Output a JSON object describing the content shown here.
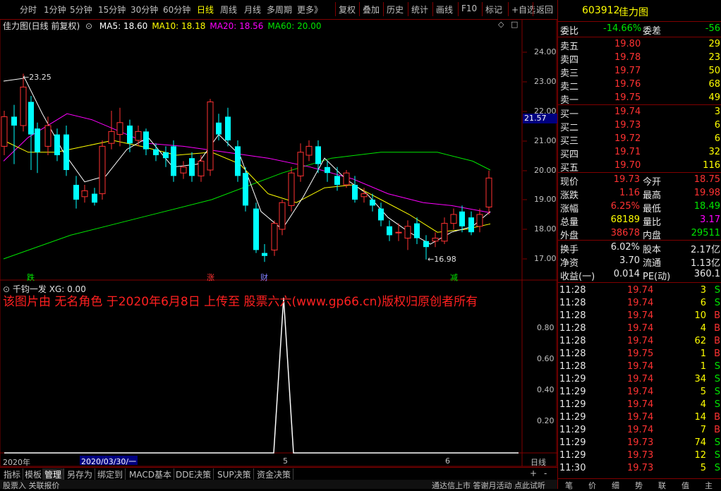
{
  "toolbar": {
    "left_items": [
      "分时",
      "1分钟",
      "5分钟",
      "15分钟",
      "30分钟",
      "60分钟",
      "日线",
      "周线",
      "月线",
      "多周期",
      "更多》"
    ],
    "active": "日线",
    "right_items": [
      "复权",
      "叠加",
      "历史",
      "统计",
      "画线",
      "F10",
      "标记",
      "+自选",
      "返回"
    ]
  },
  "main": {
    "title": "佳力图(日线 前复权)",
    "ma_labels": [
      {
        "text": "MA5: 18.60",
        "color": "#ffffff"
      },
      {
        "text": "MA10: 18.18",
        "color": "#ffff00"
      },
      {
        "text": "MA20: 18.56",
        "color": "#ff00ff"
      },
      {
        "text": "MA60: 20.00",
        "color": "#00e600"
      }
    ],
    "price_axis": [
      "24.00",
      "23.00",
      "22.00",
      "21.00",
      "20.00",
      "19.00",
      "18.00",
      "17.00"
    ],
    "current_price_tag": "21.57",
    "high_note": "23.25",
    "low_note": "16.98",
    "event_markers": [
      {
        "text": "跌",
        "color": "#00e600"
      },
      {
        "text": "涨",
        "color": "#ff3232"
      },
      {
        "text": "财",
        "color": "#8080ff"
      },
      {
        "text": "减",
        "color": "#00e600"
      }
    ],
    "pin_icon": "◇",
    "sq_icon": "□"
  },
  "indicator": {
    "name": "千钧一发",
    "value_label": "XG: 0.00",
    "watermark": "该图片由 无名角色 于2020年6月8日 上传至 股票六六(www.gp66.cn)版权归原创者所有",
    "axis": [
      "0.80",
      "0.60",
      "0.40",
      "0.20"
    ]
  },
  "dateaxis": {
    "year": "2020年",
    "cursor_date": "2020/03/30/一",
    "month5": "5",
    "month6": "6",
    "period": "日线"
  },
  "bottom_tabs": [
    "指标",
    "模板",
    "管理",
    "另存为",
    "绑定到",
    "MACD基本",
    "DDE决策",
    "SUP决策",
    "资金决策"
  ],
  "bottom_active": "管理",
  "bottom_right": [
    "+",
    "-"
  ],
  "status": {
    "left": "股票入 关联报价",
    "right": "通达信上市 答谢月活动 点此试听",
    "right_tabs": [
      "笔",
      "价",
      "细",
      "势",
      "联",
      "值",
      "主"
    ]
  },
  "quote": {
    "code": "603912",
    "name": "佳力图",
    "weibi_label": "委比",
    "weibi_value": "-14.66%",
    "weicha_label": "委差",
    "weicha_value": "-56",
    "sells": [
      {
        "label": "卖五",
        "price": "19.80",
        "vol": "29"
      },
      {
        "label": "卖四",
        "price": "19.78",
        "vol": "23"
      },
      {
        "label": "卖三",
        "price": "19.77",
        "vol": "50"
      },
      {
        "label": "卖二",
        "price": "19.76",
        "vol": "68"
      },
      {
        "label": "卖一",
        "price": "19.75",
        "vol": "49"
      }
    ],
    "buys": [
      {
        "label": "买一",
        "price": "19.74",
        "vol": "3"
      },
      {
        "label": "买二",
        "price": "19.73",
        "vol": "6"
      },
      {
        "label": "买三",
        "price": "19.72",
        "vol": "6"
      },
      {
        "label": "买四",
        "price": "19.71",
        "vol": "32"
      },
      {
        "label": "买五",
        "price": "19.70",
        "vol": "116"
      }
    ],
    "stats": [
      {
        "l1": "现价",
        "v1": "19.73",
        "c1": "red",
        "l2": "今开",
        "v2": "18.75",
        "c2": "red"
      },
      {
        "l1": "涨跌",
        "v1": "1.16",
        "c1": "red",
        "l2": "最高",
        "v2": "19.98",
        "c2": "red"
      },
      {
        "l1": "涨幅",
        "v1": "6.25%",
        "c1": "red",
        "l2": "最低",
        "v2": "18.49",
        "c2": "green"
      },
      {
        "l1": "总量",
        "v1": "68189",
        "c1": "yellow",
        "l2": "量比",
        "v2": "3.17",
        "c2": "magenta"
      },
      {
        "l1": "外盘",
        "v1": "38678",
        "c1": "red",
        "l2": "内盘",
        "v2": "29511",
        "c2": "green"
      }
    ],
    "stats2": [
      {
        "l1": "换手",
        "v1": "6.02%",
        "c1": "white",
        "l2": "股本",
        "v2": "2.17亿",
        "c2": "white"
      },
      {
        "l1": "净资",
        "v1": "3.70",
        "c1": "white",
        "l2": "流通",
        "v2": "1.13亿",
        "c2": "white"
      },
      {
        "l1": "收益(一)",
        "v1": "0.014",
        "c1": "white",
        "l2": "PE(动)",
        "v2": "360.1",
        "c2": "white"
      }
    ],
    "ticks": [
      {
        "t": "11:28",
        "p": "19.74",
        "v": "3",
        "s": "S"
      },
      {
        "t": "11:28",
        "p": "19.74",
        "v": "6",
        "s": "S"
      },
      {
        "t": "11:28",
        "p": "19.74",
        "v": "10",
        "s": "B"
      },
      {
        "t": "11:28",
        "p": "19.74",
        "v": "4",
        "s": "B"
      },
      {
        "t": "11:28",
        "p": "19.74",
        "v": "62",
        "s": "B"
      },
      {
        "t": "11:28",
        "p": "19.75",
        "v": "1",
        "s": "B"
      },
      {
        "t": "11:28",
        "p": "19.74",
        "v": "1",
        "s": "S"
      },
      {
        "t": "11:29",
        "p": "19.74",
        "v": "34",
        "s": "S"
      },
      {
        "t": "11:29",
        "p": "19.74",
        "v": "5",
        "s": "S"
      },
      {
        "t": "11:29",
        "p": "19.74",
        "v": "4",
        "s": "S"
      },
      {
        "t": "11:29",
        "p": "19.74",
        "v": "14",
        "s": "B"
      },
      {
        "t": "11:29",
        "p": "19.74",
        "v": "7",
        "s": "B"
      },
      {
        "t": "11:29",
        "p": "19.73",
        "v": "74",
        "s": "S"
      },
      {
        "t": "11:29",
        "p": "19.73",
        "v": "12",
        "s": "S"
      },
      {
        "t": "11:30",
        "p": "19.73",
        "v": "5",
        "s": "S"
      }
    ]
  },
  "colors": {
    "up": "#ff3232",
    "down": "#00ffff",
    "grid": "#800000",
    "ma5": "#ffffff",
    "ma10": "#ffff00",
    "ma20": "#ff00ff",
    "ma60": "#00e600"
  }
}
